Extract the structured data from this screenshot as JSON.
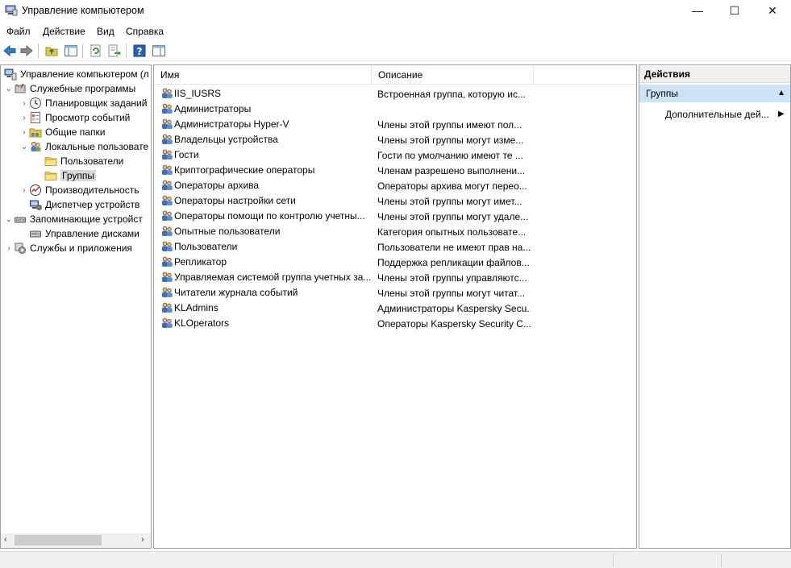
{
  "window": {
    "title": "Управление компьютером",
    "minimize": "—",
    "maximize": "☐",
    "close": "✕"
  },
  "menu": [
    "Файл",
    "Действие",
    "Вид",
    "Справка"
  ],
  "tree": {
    "items": [
      {
        "label": "Управление компьютером (л",
        "icon": "computer-management-icon",
        "chevron": "",
        "level": 0
      },
      {
        "label": "Служебные программы",
        "icon": "tools-icon",
        "chevron": "⌄",
        "level": 1
      },
      {
        "label": "Планировщик заданий",
        "icon": "clock-icon",
        "chevron": "›",
        "level": 2
      },
      {
        "label": "Просмотр событий",
        "icon": "event-viewer-icon",
        "chevron": "›",
        "level": 2
      },
      {
        "label": "Общие папки",
        "icon": "shared-folder-icon",
        "chevron": "›",
        "level": 2
      },
      {
        "label": "Локальные пользовате",
        "icon": "users-icon",
        "chevron": "⌄",
        "level": 2
      },
      {
        "label": "Пользователи",
        "icon": "folder-icon",
        "chevron": "",
        "level": 3
      },
      {
        "label": "Группы",
        "icon": "folder-icon",
        "chevron": "",
        "level": 3,
        "selected": true
      },
      {
        "label": "Производительность",
        "icon": "performance-icon",
        "chevron": "›",
        "level": 2
      },
      {
        "label": "Диспетчер устройств",
        "icon": "device-manager-icon",
        "chevron": "",
        "level": 2
      },
      {
        "label": "Запоминающие устройст",
        "icon": "storage-icon",
        "chevron": "⌄",
        "level": 1
      },
      {
        "label": "Управление дисками",
        "icon": "disk-icon",
        "chevron": "",
        "level": 2
      },
      {
        "label": "Службы и приложения",
        "icon": "services-icon",
        "chevron": "›",
        "level": 1
      }
    ],
    "scroll_left": "‹",
    "scroll_right": "›"
  },
  "list": {
    "columns": [
      "Имя",
      "Описание"
    ],
    "rows": [
      {
        "name": "IIS_IUSRS",
        "description": "Встроенная группа, которую ис..."
      },
      {
        "name": "Администраторы",
        "description": ""
      },
      {
        "name": "Администраторы Hyper-V",
        "description": "Члены этой группы имеют пол..."
      },
      {
        "name": "Владельцы устройства",
        "description": "Члены этой группы могут изме..."
      },
      {
        "name": "Гости",
        "description": "Гости по умолчанию имеют те ..."
      },
      {
        "name": "Криптографические операторы",
        "description": "Членам разрешено выполнени..."
      },
      {
        "name": "Операторы архива",
        "description": "Операторы архива могут перео..."
      },
      {
        "name": "Операторы настройки сети",
        "description": "Члены этой группы могут имет..."
      },
      {
        "name": "Операторы помощи по контролю учетны...",
        "description": "Члены этой группы могут удале..."
      },
      {
        "name": "Опытные пользователи",
        "description": "Категория опытных пользовате..."
      },
      {
        "name": "Пользователи",
        "description": "Пользователи не имеют прав на..."
      },
      {
        "name": "Репликатор",
        "description": "Поддержка репликации файлов..."
      },
      {
        "name": "Управляемая системой группа учетных за...",
        "description": "Члены этой группы управляютс..."
      },
      {
        "name": "Читатели журнала событий",
        "description": "Члены этой группы могут читат..."
      },
      {
        "name": "KLAdmins",
        "description": "Администраторы Kaspersky Secu..."
      },
      {
        "name": "KLOperators",
        "description": "Операторы Kaspersky Security C..."
      }
    ]
  },
  "actions": {
    "title": "Действия",
    "group": "Группы",
    "group_caret": "▲",
    "more": "Дополнительные дей...",
    "more_caret": "▶"
  },
  "colors": {
    "selection": "#cce4f7",
    "tree_selected": "#d9d9d9"
  }
}
